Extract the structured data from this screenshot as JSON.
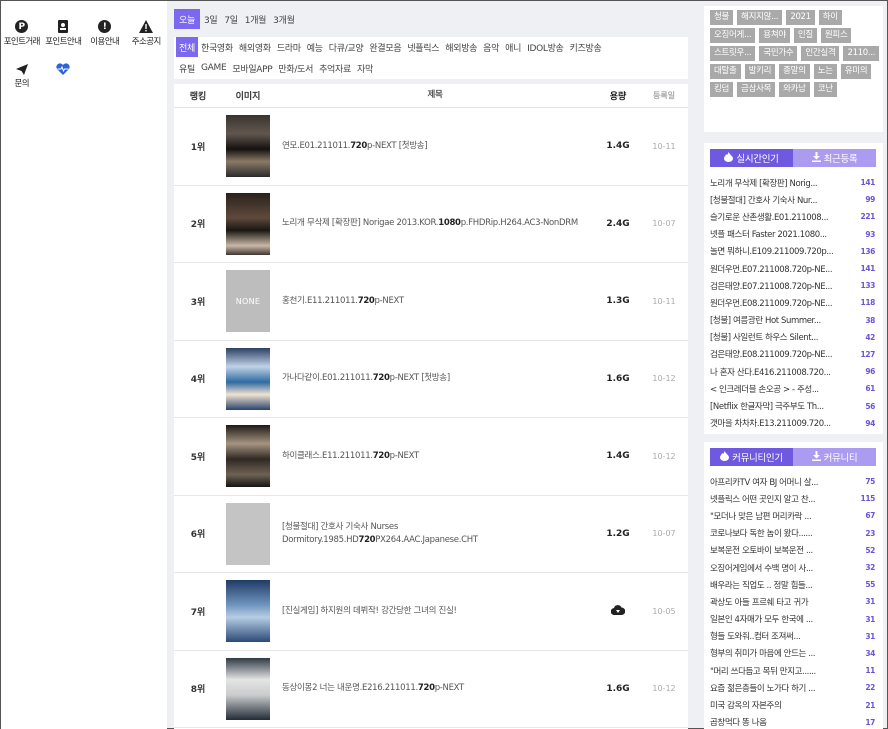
{
  "left_nav": [
    {
      "label": "포인트거래",
      "icon": "p-coin-icon"
    },
    {
      "label": "포인트안내",
      "icon": "contact-book-icon"
    },
    {
      "label": "이용안내",
      "icon": "info-icon"
    },
    {
      "label": "주소공지",
      "icon": "warning-icon"
    },
    {
      "label": "문의",
      "icon": "send-icon"
    },
    {
      "label": "",
      "icon": "heart-pulse-icon"
    }
  ],
  "periods": [
    {
      "label": "오늘",
      "active": true
    },
    {
      "label": "3일",
      "active": false
    },
    {
      "label": "7일",
      "active": false
    },
    {
      "label": "1개월",
      "active": false
    },
    {
      "label": "3개월",
      "active": false
    }
  ],
  "categories_row1": [
    {
      "label": "전체",
      "active": true
    },
    {
      "label": "한국영화",
      "active": false
    },
    {
      "label": "해외영화",
      "active": false
    },
    {
      "label": "드라마",
      "active": false
    },
    {
      "label": "예능",
      "active": false
    },
    {
      "label": "다큐/교양",
      "active": false
    },
    {
      "label": "완결모음",
      "active": false
    },
    {
      "label": "넷플릭스",
      "active": false
    },
    {
      "label": "해외방송",
      "active": false
    },
    {
      "label": "음악",
      "active": false
    },
    {
      "label": "애니",
      "active": false
    },
    {
      "label": "IDOL방송",
      "active": false
    },
    {
      "label": "키즈방송",
      "active": false
    }
  ],
  "categories_row2": [
    {
      "label": "유틸",
      "active": false
    },
    {
      "label": "GAME",
      "active": false
    },
    {
      "label": "모바일APP",
      "active": false
    },
    {
      "label": "만화/도서",
      "active": false
    },
    {
      "label": "추억자료",
      "active": false
    },
    {
      "label": "자막",
      "active": false
    }
  ],
  "table": {
    "headers": {
      "rank": "랭킹",
      "image": "이미지",
      "title": "제목",
      "size": "용량",
      "date": "등록일"
    },
    "rows": [
      {
        "rank": "1위",
        "thumb": "t1",
        "thumb_text": "",
        "title_parts": [
          "연모.E01.211011.",
          "720",
          "p-NEXT [첫방송]"
        ],
        "size": "1.4G",
        "date": "10-11"
      },
      {
        "rank": "2위",
        "thumb": "t2",
        "thumb_text": "",
        "title_parts": [
          "노리개 무삭제 [확장판] Norigae 2013.KOR.",
          "1080",
          "p.FHDRip.H264.AC3-NonDRM"
        ],
        "size": "2.4G",
        "date": "10-07"
      },
      {
        "rank": "3위",
        "thumb": "t3",
        "thumb_text": "NONE",
        "title_parts": [
          "홍천기.E11.211011.",
          "720",
          "p-NEXT"
        ],
        "size": "1.3G",
        "date": "10-11"
      },
      {
        "rank": "4위",
        "thumb": "t4",
        "thumb_text": "",
        "title_parts": [
          "가나다같이.E01.211011.",
          "720",
          "p-NEXT [첫방송]"
        ],
        "size": "1.6G",
        "date": "10-12"
      },
      {
        "rank": "5위",
        "thumb": "t5",
        "thumb_text": "",
        "title_parts": [
          "하이클래스.E11.211011.",
          "720",
          "p-NEXT"
        ],
        "size": "1.4G",
        "date": "10-12"
      },
      {
        "rank": "6위",
        "thumb": "t6",
        "thumb_text": "",
        "title_parts": [
          "[청불절대] 간호사 기숙사 Nurses Dormitory.1985.HD",
          "720",
          "PX264.AAC.Japanese.CHT"
        ],
        "size": "1.2G",
        "date": "10-07"
      },
      {
        "rank": "7위",
        "thumb": "t7",
        "thumb_text": "",
        "title_parts": [
          "[진실게임] 하지원의 데뷔작! 강간당한 그녀의 진실!",
          "",
          ""
        ],
        "size": "",
        "size_icon": "cloud-download-icon",
        "date": "10-05"
      },
      {
        "rank": "8위",
        "thumb": "t8",
        "thumb_text": "",
        "title_parts": [
          "동상이몽2 너는 내운명.E216.211011.",
          "720",
          "p-NEXT"
        ],
        "size": "1.6G",
        "date": "10-12"
      }
    ]
  },
  "tags": [
    "청불",
    "해지지않...",
    "2021",
    "하이",
    "오징어게...",
    "용쳐야",
    "인질",
    "원피스",
    "스트릿우...",
    "국민가수",
    "인간실격",
    "2110...",
    "대탈출",
    "발키리",
    "종말의",
    "노는",
    "유미의",
    "킹덤",
    "금삼사목",
    "와카남",
    "코난"
  ],
  "popular": {
    "tab_active": "실시간인기",
    "tab_other": "최근등록",
    "items": [
      {
        "title": "노리개 무삭제 [확장판] Norig...",
        "count": "141"
      },
      {
        "title": "[청불절대] 간호사 기숙사 Nur...",
        "count": "99"
      },
      {
        "title": "슬기로운 산촌생활.E01.211008...",
        "count": "221"
      },
      {
        "title": "넷플 패스터 Faster 2021.1080...",
        "count": "93"
      },
      {
        "title": "놀면 뭐하니.E109.211009.720p...",
        "count": "136"
      },
      {
        "title": "원더우먼.E07.211008.720p-NE...",
        "count": "141"
      },
      {
        "title": "검은태양.E07.211008.720p-NE...",
        "count": "133"
      },
      {
        "title": "원더우먼.E08.211009.720p-NE...",
        "count": "118"
      },
      {
        "title": "[청불] 여름광란 Hot Summer...",
        "count": "38"
      },
      {
        "title": "[청불] 사일런트 하우스 Silent...",
        "count": "42"
      },
      {
        "title": "검은태양.E08.211009.720p-NE...",
        "count": "127"
      },
      {
        "title": "나 혼자 산다.E416.211008.720...",
        "count": "96"
      },
      {
        "title": "< 인크레더블 손오공 > - 주성...",
        "count": "61"
      },
      {
        "title": "[Netflix 한글자막] 극주부도 Th...",
        "count": "56"
      },
      {
        "title": "갯마을 차차차.E13.211009.720...",
        "count": "94"
      }
    ]
  },
  "community": {
    "tab_active": "커뮤니티인기",
    "tab_other": "커뮤니티",
    "items": [
      {
        "title": "아프리카TV 여자 BJ 어머니 살...",
        "count": "75"
      },
      {
        "title": "넷플릭스 어떤 곳인지 알고 찬...",
        "count": "115"
      },
      {
        "title": "\"모더나 맞은 남편 머리카락 ...",
        "count": "67"
      },
      {
        "title": "코로나보다 독한 놈이 왔다......",
        "count": "23"
      },
      {
        "title": "보복운전 오토바이 보복운전 ...",
        "count": "52"
      },
      {
        "title": "오징어게임에서 수백 명이 사...",
        "count": "32"
      },
      {
        "title": "배우라는 직업도 .. 정말 힘들...",
        "count": "55"
      },
      {
        "title": "곽상도 아들 프르쉐 타고 귀가",
        "count": "31"
      },
      {
        "title": "일본인 4자매가 모두 한국에 ...",
        "count": "31"
      },
      {
        "title": "형들 도와줘..컴터 조져써...",
        "count": "31"
      },
      {
        "title": "형부의 취미가 마음에 안드는 ...",
        "count": "34"
      },
      {
        "title": "\"머리 쓰다듬고 목뒤 만지고......",
        "count": "11"
      },
      {
        "title": "요즘 젊은층들이 노가다 하기 ...",
        "count": "22"
      },
      {
        "title": "미국 감옥의 자본주의",
        "count": "21"
      },
      {
        "title": "곱창먹다 똥 나옴",
        "count": "17"
      }
    ]
  }
}
